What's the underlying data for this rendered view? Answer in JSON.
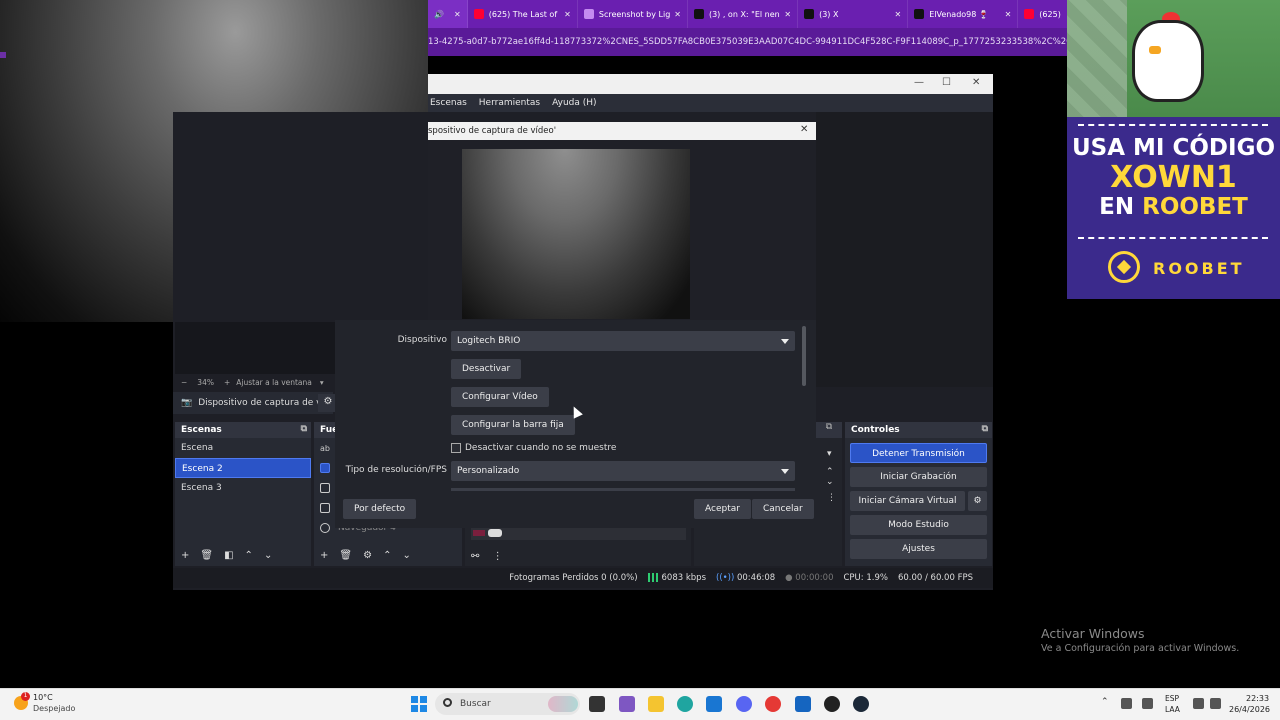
{
  "browser": {
    "tabs": [
      {
        "label": "(625) The Last of",
        "color": "#ff0033",
        "icon": "youtube-icon"
      },
      {
        "label": "Screenshot by Lig",
        "color": "#c48bf0",
        "icon": "pen-icon"
      },
      {
        "label": "(3) , on X: \"El nen",
        "color": "#111111",
        "icon": "x-icon"
      },
      {
        "label": "(3) X",
        "color": "#111111",
        "icon": "x-icon"
      },
      {
        "label": "ElVenado98 🍷",
        "color": "#111111",
        "icon": "tiktok-icon"
      },
      {
        "label": "(625) ",
        "color": "#ff0033",
        "icon": "youtube-icon"
      }
    ],
    "url": "13-4275-a0d7-b772ae16ff4d-118773372%2CNES_5SDD57FA8CB0E375039E3AAD07C4DC-994911DC4F528C-F9F114089C_p_1777253233538%2C%2C%2C%"
  },
  "banner": {
    "line1": "USA MI CÓDIGO",
    "line2": "XOWN1",
    "line3a": "EN ",
    "line3b": "ROOBET",
    "logo": "ROOBET",
    "bg": "#3b2a8c",
    "accent": "#ffd83a"
  },
  "obs": {
    "window_controls": [
      "—",
      "☐",
      "✕"
    ],
    "menu": [
      "Escenas",
      "Herramientas",
      "Ayuda (H)"
    ],
    "zoom": {
      "minus": "−",
      "value": "34%",
      "plus": "+",
      "fit": "Ajustar a la ventana"
    },
    "source_toolbar_label": "Dispositivo de captura de v",
    "scenes": {
      "title": "Escenas",
      "items": [
        "Escena",
        "Escena 2",
        "Escena 3"
      ],
      "active_index": 1
    },
    "sources": {
      "title": "Fue",
      "last_item": "Navegador 4"
    },
    "controls": {
      "title": "Controles",
      "buttons": [
        "Detener Transmisión",
        "Iniciar Grabación",
        "Iniciar Cámara Virtual",
        "Modo Estudio",
        "Ajustes"
      ]
    },
    "status": {
      "dropped": "Fotogramas Perdidos 0 (0.0%)",
      "kbps": "6083 kbps",
      "stream_time": "00:46:08",
      "rec_time": "00:00:00",
      "cpu": "CPU: 1.9%",
      "fps": "60.00 / 60.00 FPS"
    }
  },
  "dialog": {
    "title": "spositivo de captura de vídeo'",
    "device_label": "Dispositivo",
    "device_value": "Logitech BRIO",
    "btn_deactivate": "Desactivar",
    "btn_config_video": "Configurar Vídeo",
    "btn_config_bar": "Configurar la barra fija",
    "checkbox_label": "Desactivar cuando no se muestre",
    "res_label": "Tipo de resolución/FPS",
    "res_value": "Personalizado",
    "btn_default": "Por defecto",
    "btn_accept": "Aceptar",
    "btn_cancel": "Cancelar"
  },
  "watermark": {
    "line1": "Activar Windows",
    "line2": "Ve a Configuración para activar Windows."
  },
  "taskbar": {
    "weather_temp": "10°C",
    "weather_desc": "Despejado",
    "weather_badge": "1",
    "search_placeholder": "Buscar",
    "lang1": "ESP",
    "lang2": "LAA",
    "time": "22:33",
    "date": "26/4/2026"
  }
}
